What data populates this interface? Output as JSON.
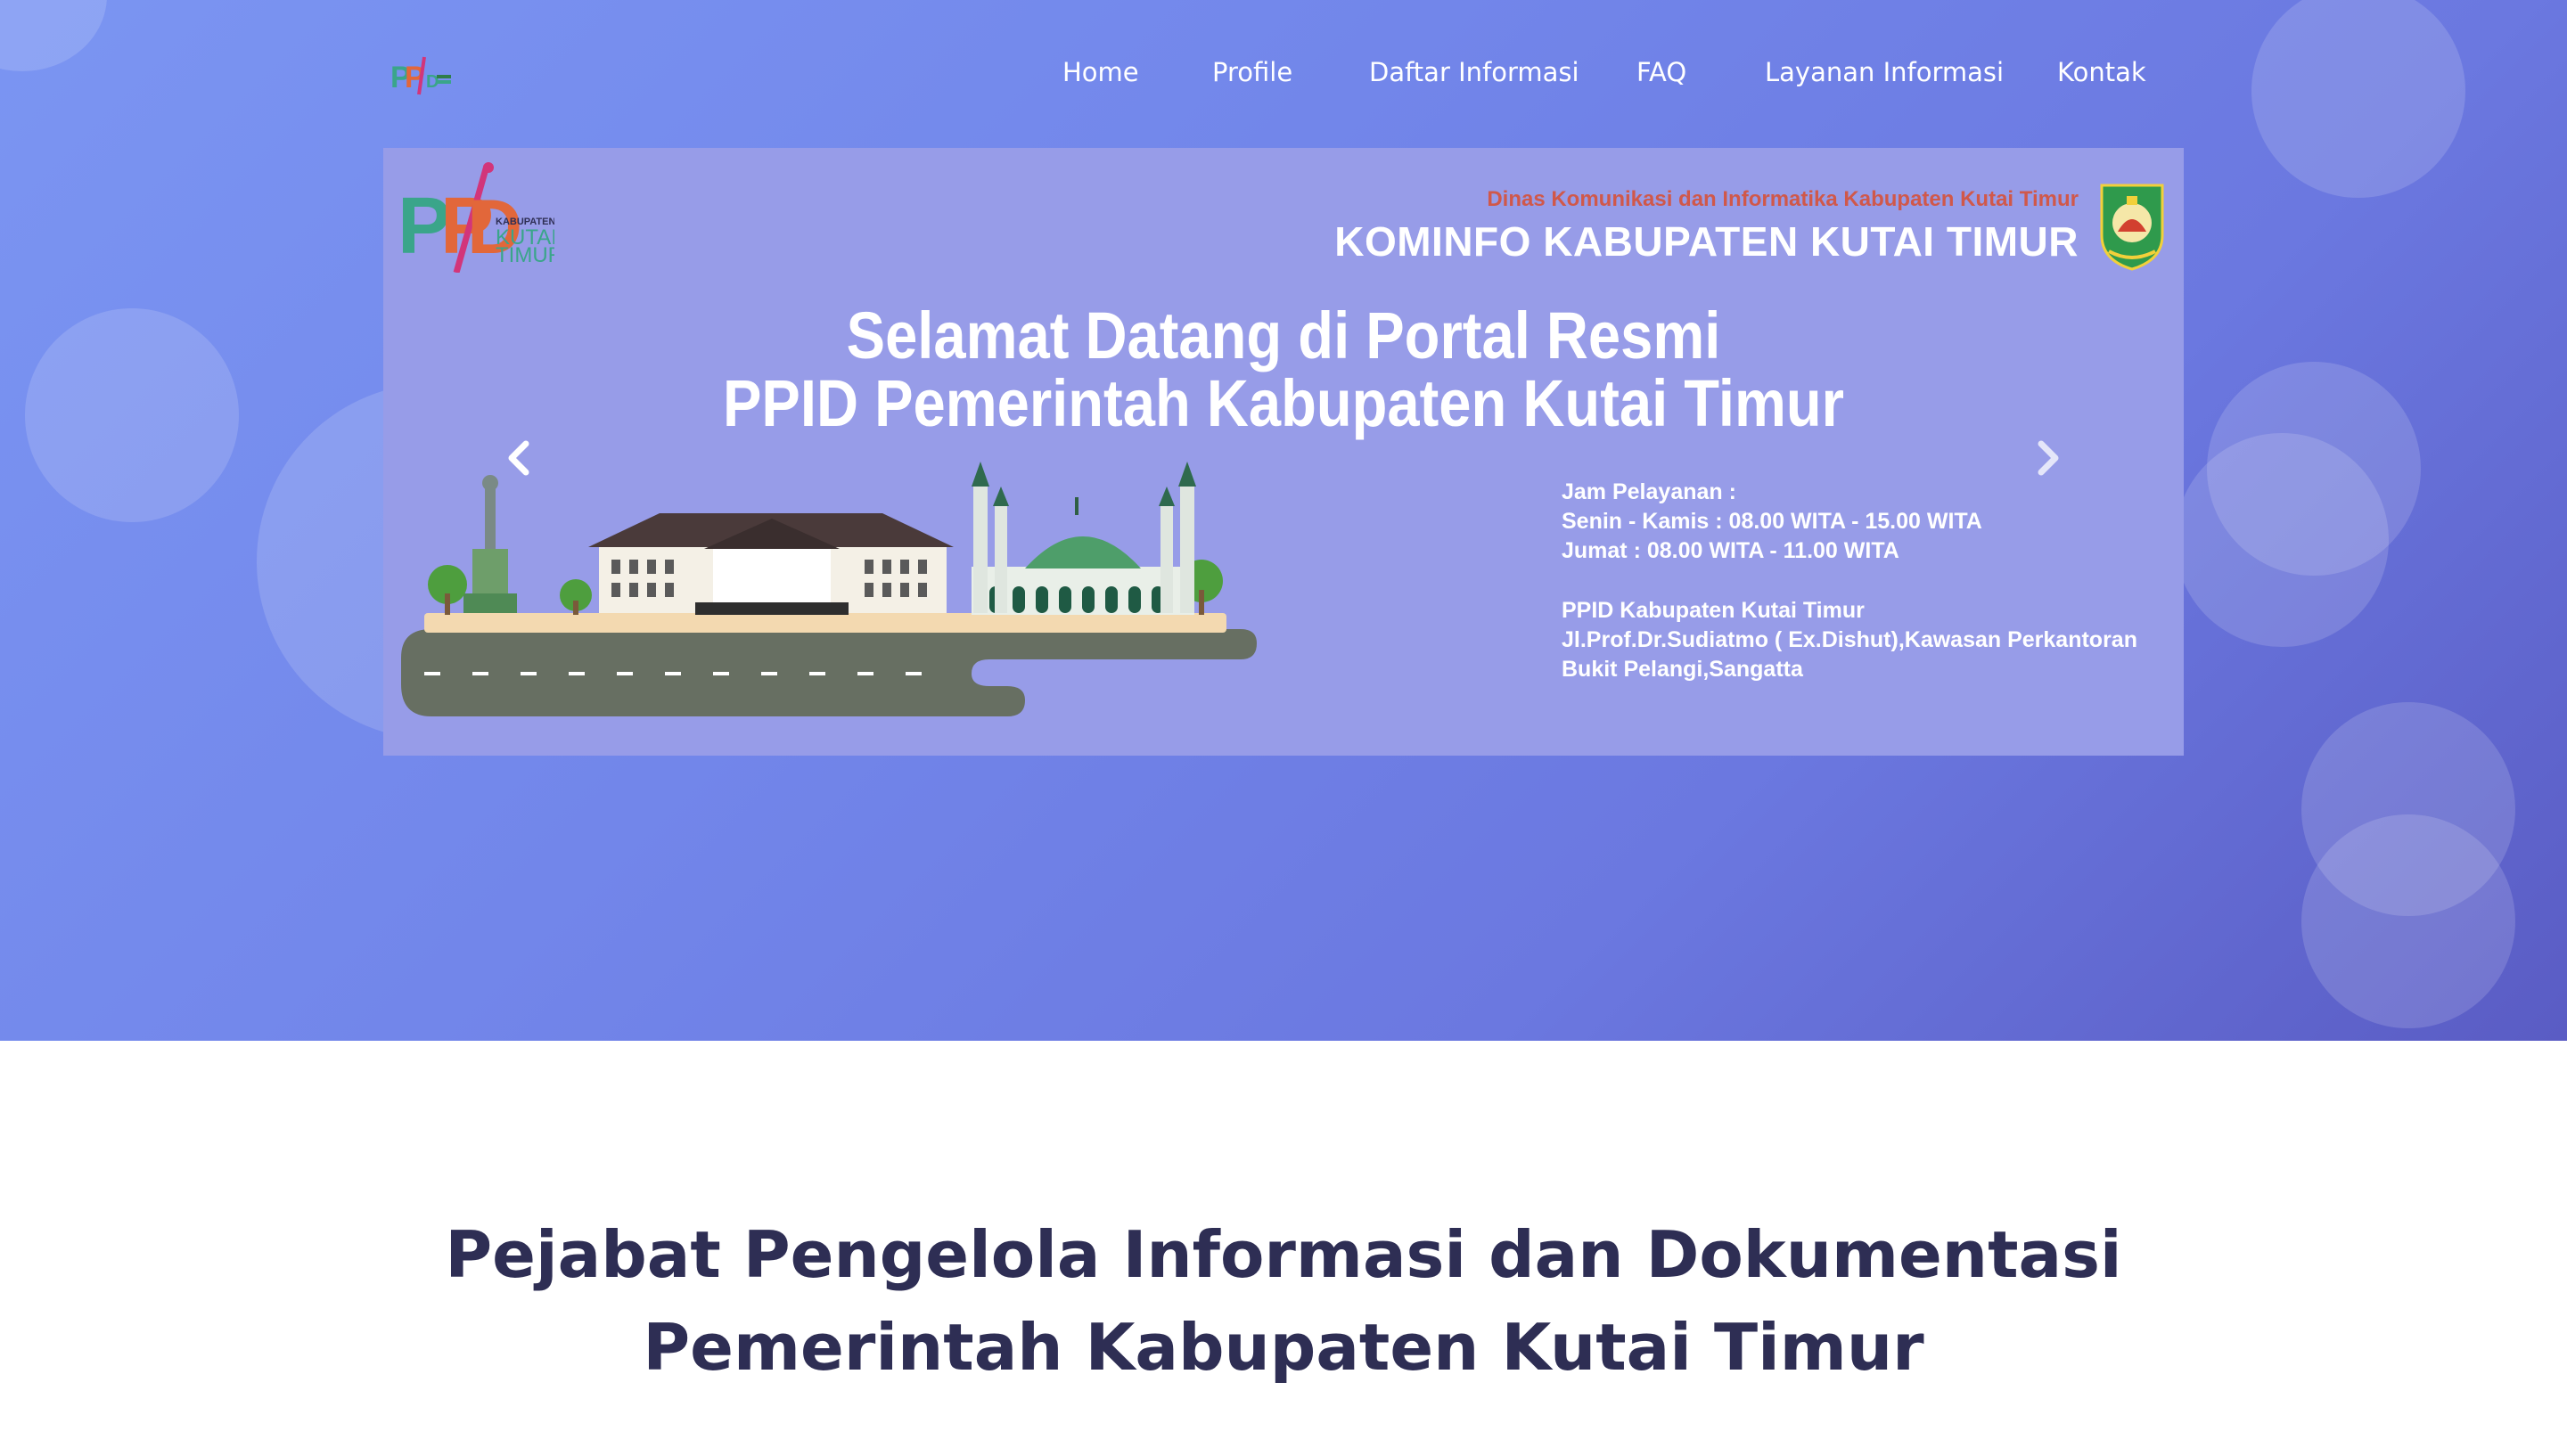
{
  "colors": {
    "hero_gradient_start": "#7b95f2",
    "hero_gradient_end": "#5a5cc4",
    "carousel_bg": "#979ce8",
    "section_title": "#2e2e54",
    "dinas_text": "#d0584a",
    "white": "#ffffff"
  },
  "navbar": {
    "logo_icon": "ppid-logo-icon",
    "menu": [
      {
        "label": "Home"
      },
      {
        "label": "Profile"
      },
      {
        "label": "Daftar Informasi"
      },
      {
        "label": "FAQ"
      },
      {
        "label": "Layanan Informasi"
      },
      {
        "label": "Kontak"
      }
    ]
  },
  "carousel": {
    "logo": {
      "letters": "PPID",
      "sub1": "KABUPATEN",
      "sub2": "KUTAI",
      "sub3": "TIMUR"
    },
    "dinas": "Dinas Komunikasi dan Informatika Kabupaten Kutai Timur",
    "kominfo": "KOMINFO KABUPATEN KUTAI TIMUR",
    "headline_line1": "Selamat Datang di Portal Resmi",
    "headline_line2": "PPID Pemerintah Kabupaten Kutai Timur",
    "jam_title": "Jam Pelayanan :",
    "jam_weekday": "Senin - Kamis : 08.00 WITA - 15.00 WITA",
    "jam_friday": "Jumat : 08.00 WITA - 11.00 WITA",
    "address_title": "PPID Kabupaten Kutai Timur",
    "address_line1": "Jl.Prof.Dr.Sudiatmo ( Ex.Dishut),Kawasan Perkantoran",
    "address_line2": "Bukit Pelangi,Sangatta",
    "prev_icon": "chevron-left-icon",
    "next_icon": "chevron-right-icon"
  },
  "section": {
    "title_line1": "Pejabat Pengelola Informasi dan Dokumentasi",
    "title_line2": "Pemerintah Kabupaten Kutai Timur"
  }
}
